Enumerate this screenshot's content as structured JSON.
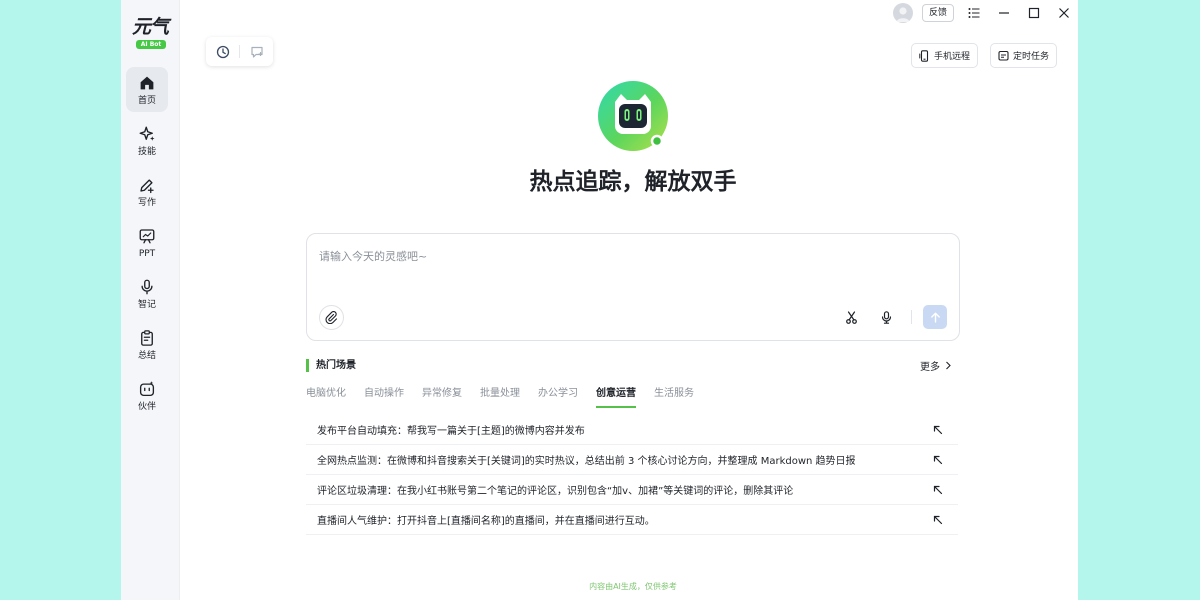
{
  "logo": {
    "text": "元气",
    "badge": "AI Bot"
  },
  "sidebar": {
    "items": [
      {
        "label": "首页",
        "icon": "home-icon",
        "active": true
      },
      {
        "label": "技能",
        "icon": "sparkle-icon",
        "active": false
      },
      {
        "label": "写作",
        "icon": "pen-icon",
        "active": false
      },
      {
        "label": "PPT",
        "icon": "presentation-icon",
        "active": false
      },
      {
        "label": "智记",
        "icon": "microphone-icon",
        "active": false
      },
      {
        "label": "总结",
        "icon": "clipboard-icon",
        "active": false
      },
      {
        "label": "伙伴",
        "icon": "robot-face-icon",
        "active": false
      }
    ]
  },
  "titlebar": {
    "feedback_label": "反馈"
  },
  "toolbar": {
    "phone_remote_label": "手机远程",
    "scheduled_task_label": "定时任务"
  },
  "hero": {
    "headline": "热点追踪，解放双手"
  },
  "input": {
    "placeholder": "请输入今天的灵感吧~"
  },
  "hot_scenes": {
    "title": "热门场景",
    "more_label": "更多",
    "tabs": [
      "电脑优化",
      "自动操作",
      "异常修复",
      "批量处理",
      "办公学习",
      "创意运营",
      "生活服务"
    ],
    "active_tab": "创意运营",
    "items": [
      "发布平台自动填充：帮我写一篇关于[主题]的微博内容并发布",
      "全网热点监测：在微博和抖音搜索关于[关键词]的实时热议，总结出前 3 个核心讨论方向，并整理成 Markdown 趋势日报",
      "评论区垃圾清理：在我小红书账号第二个笔记的评论区，识别包含“加v、加裙”等关键词的评论，删除其评论",
      "直播间人气维护：打开抖音上[直播间名称]的直播间，并在直播间进行互动。"
    ]
  },
  "footer": {
    "disclaimer": "内容由AI生成，仅供参考"
  },
  "colors": {
    "accent": "#55c14a",
    "brand_green": "#45c945",
    "send_button": "#c9d9f4"
  }
}
